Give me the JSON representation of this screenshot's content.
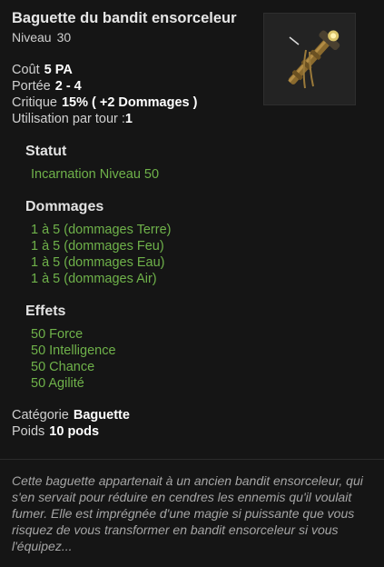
{
  "item": {
    "name": "Baguette du bandit ensorceleur",
    "level_label": "Niveau",
    "level_value": "30",
    "icon": "wand-icon"
  },
  "stats": [
    {
      "label": "Coût",
      "value": "5 PA"
    },
    {
      "label": "Portée",
      "value": "2 - 4"
    },
    {
      "label": "Critique",
      "value": "15% ( +2 Dommages )"
    },
    {
      "label": "Utilisation par tour :",
      "value": "1"
    }
  ],
  "sections": {
    "statut": {
      "title": "Statut",
      "items": [
        "Incarnation Niveau 50"
      ]
    },
    "dommages": {
      "title": "Dommages",
      "items": [
        "1 à 5 (dommages Terre)",
        "1 à 5 (dommages Feu)",
        "1 à 5 (dommages Eau)",
        "1 à 5 (dommages Air)"
      ]
    },
    "effets": {
      "title": "Effets",
      "items": [
        "50 Force",
        "50 Intelligence",
        "50 Chance",
        "50 Agilité"
      ]
    }
  },
  "meta": {
    "category_label": "Catégorie",
    "category_value": "Baguette",
    "weight_label": "Poids",
    "weight_value": "10 pods"
  },
  "description": "Cette baguette appartenait à un ancien bandit ensorceleur, qui s'en servait pour réduire en cendres les ennemis qu'il voulait fumer. Elle est imprégnée d'une magie si puissante que vous risquez de vous transformer en bandit ensorceleur si vous l'équipez...",
  "colors": {
    "background": "#151515",
    "effect_green": "#6fb24a",
    "title_text": "#e6e6e6",
    "description_text": "#a5a5a5"
  }
}
